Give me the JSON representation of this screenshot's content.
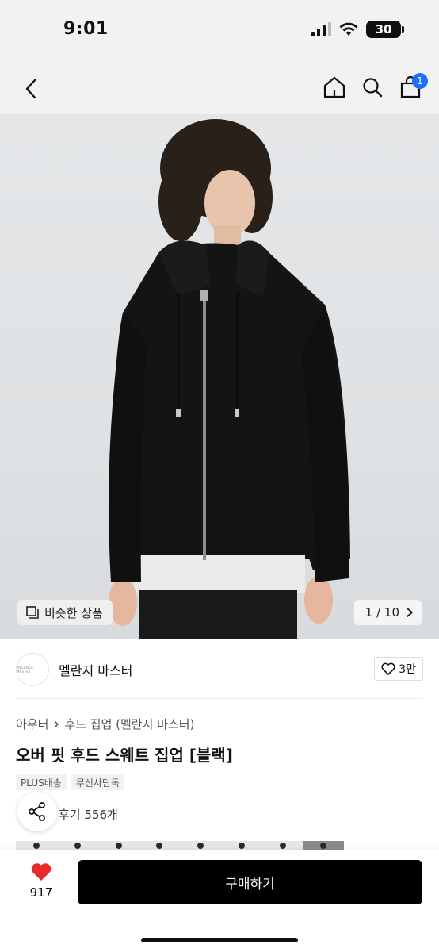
{
  "status_bar": {
    "time": "9:01",
    "battery": "30"
  },
  "nav": {
    "cart_count": "1"
  },
  "hero": {
    "similar_label": "비슷한 상품",
    "counter": "1 / 10"
  },
  "brand": {
    "logo_text": "MELANGE MASTER",
    "name": "멜란지 마스터",
    "likes": "3만"
  },
  "breadcrumb": {
    "category": "아우터",
    "subcategory": "후드 집업 (멜란지 마스터)"
  },
  "product": {
    "title": "오버 핏 후드 스웨트 집업 [블랙]",
    "tags": [
      "PLUS배송",
      "무신사단독"
    ],
    "reviews": "후기 556개"
  },
  "bottom": {
    "favorite_count": "917",
    "buy_label": "구매하기"
  },
  "colors": {
    "accent_badge": "#1f6fff",
    "heart": "#e52b2b",
    "buy_button": "#000000"
  },
  "icons": [
    "chevron-left-icon",
    "home-icon",
    "search-icon",
    "shopping-bag-icon",
    "similar-icon",
    "chevron-right-icon",
    "heart-outline-icon",
    "share-icon",
    "heart-filled-icon"
  ]
}
